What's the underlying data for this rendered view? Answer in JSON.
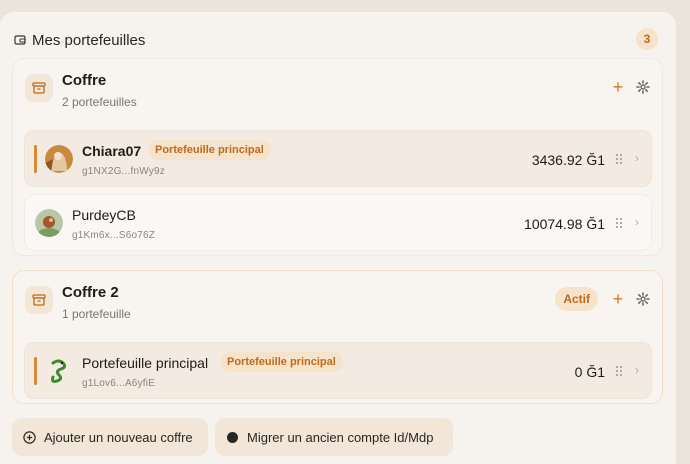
{
  "header": {
    "title": "Mes portefeuilles",
    "count": "3"
  },
  "vaults": [
    {
      "name": "Coffre",
      "subtitle": "2 portefeuilles",
      "add_label": "+",
      "wallets": [
        {
          "name": "Chiara07",
          "badge": "Portefeuille principal",
          "address": "g1NX2G...fnWy9z",
          "balance": "3436.92 Ğ1",
          "chevron": "›"
        },
        {
          "name": "PurdeyCB",
          "address": "g1Km6x...S6o76Z",
          "balance": "10074.98 Ğ1",
          "chevron": "›"
        }
      ]
    },
    {
      "name": "Coffre 2",
      "subtitle": "1 portefeuille",
      "status": "Actif",
      "add_label": "+",
      "wallets": [
        {
          "name": "Portefeuille principal",
          "badge": "Portefeuille principal",
          "address": "g1Lov6...A6yfiE",
          "balance": "0 Ğ1",
          "chevron": "›"
        }
      ]
    }
  ],
  "footer": {
    "add_vault": "Ajouter un nouveau coffre",
    "migrate": "Migrer un ancien compte Id/Mdp"
  },
  "colors": {
    "accent": "#d07b1e",
    "badge_bg": "#f6e3cc",
    "badge_text": "#c06a1a"
  },
  "icons": [
    "wallet-icon",
    "archive-icon",
    "plus-icon",
    "gear-icon",
    "drag-handle-icon",
    "chevron-right-icon",
    "plus-circle-icon",
    "dot-icon"
  ]
}
